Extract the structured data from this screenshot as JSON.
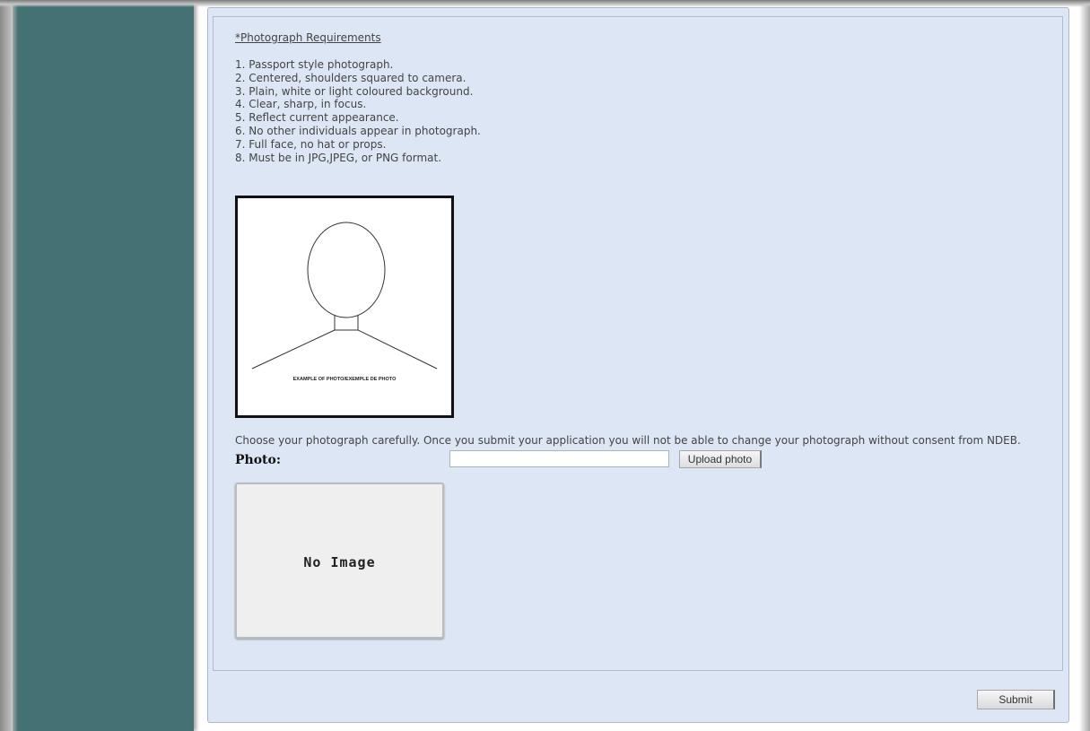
{
  "requirements": {
    "title": "*Photograph Requirements ",
    "items": [
      "1. Passport style photograph.",
      "2. Centered, shoulders squared to camera.",
      "3. Plain, white or light coloured background.",
      "4. Clear, sharp, in focus.",
      "5. Reflect current appearance.",
      "6. No other individuals appear in photograph.",
      "7. Full face, no hat or props.",
      "8. Must be in JPG,JPEG, or PNG format."
    ]
  },
  "sample_photo": {
    "caption": "EXAMPLE OF PHOTO/EXEMPLE DE PHOTO"
  },
  "upload": {
    "note": "Choose your photograph carefully. Once you submit your application you will not be able to change your photograph without consent from NDEB.",
    "label": "Photo:",
    "file_value": "",
    "button_label": "Upload photo"
  },
  "preview": {
    "placeholder_text": "No Image"
  },
  "form": {
    "submit_label": "Submit"
  },
  "colors": {
    "sidebar": "#447173",
    "panel": "#dde6f4"
  }
}
